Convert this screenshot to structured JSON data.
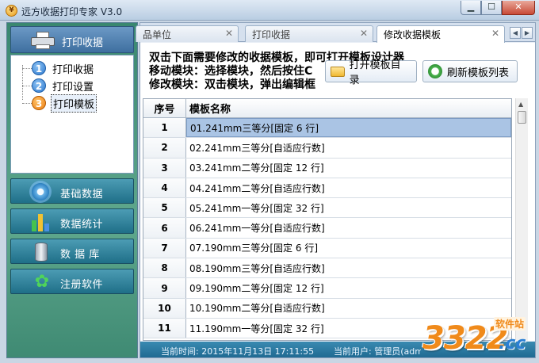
{
  "window": {
    "title": "远方收据打印专家 V3.0",
    "app_icon_glyph": "¥"
  },
  "colors": {
    "accent": "#3e6f9f",
    "nav_button": "#1f6f88",
    "left_panel": "#5fa88d",
    "selection": "#aac4e4",
    "statusbar": "#1f6a92"
  },
  "left_panel": {
    "header_label": "打印收据",
    "header_icon": "printer-icon",
    "tree": [
      {
        "num": "1",
        "label": "打印收据",
        "color": "#2c78cf"
      },
      {
        "num": "2",
        "label": "打印设置",
        "color": "#2c78cf"
      },
      {
        "num": "3",
        "label": "打印模板",
        "color": "#ec7d10",
        "selected": true
      }
    ],
    "nav_buttons": [
      {
        "label": "基础数据",
        "icon": "gear-icon"
      },
      {
        "label": "数据统计",
        "icon": "bar-chart-icon"
      },
      {
        "label": "数 据 库",
        "icon": "database-icon"
      },
      {
        "label": "注册软件",
        "icon": "leaf-icon"
      }
    ]
  },
  "tabs": [
    {
      "label": "品单位",
      "active": false
    },
    {
      "label": "打印收据",
      "active": false
    },
    {
      "label": "修改收据模板",
      "active": true
    }
  ],
  "tab_nav": {
    "left": "◀",
    "right": "▶"
  },
  "instructions": [
    "双击下面需要修改的收据模板，即可打开模板设计器",
    "移动模块：选择模块，然后按住C",
    "修改模块：双击模块，弹出编辑框"
  ],
  "toolbar": {
    "open_dir_label": "打开模板目录",
    "refresh_label": "刷新模板列表"
  },
  "grid": {
    "columns": [
      "序号",
      "模板名称"
    ],
    "rows": [
      {
        "no": "1",
        "name": "01.241mm三等分[固定 6 行]",
        "selected": true
      },
      {
        "no": "2",
        "name": "02.241mm三等分[自适应行数]"
      },
      {
        "no": "3",
        "name": "03.241mm二等分[固定 12 行]"
      },
      {
        "no": "4",
        "name": "04.241mm二等分[自适应行数]"
      },
      {
        "no": "5",
        "name": "05.241mm一等分[固定 32 行]"
      },
      {
        "no": "6",
        "name": "06.241mm一等分[自适应行数]"
      },
      {
        "no": "7",
        "name": "07.190mm三等分[固定 6 行]"
      },
      {
        "no": "8",
        "name": "08.190mm三等分[自适应行数]"
      },
      {
        "no": "9",
        "name": "09.190mm二等分[固定 12 行]"
      },
      {
        "no": "10",
        "name": "10.190mm二等分[自适应行数]"
      },
      {
        "no": "11",
        "name": "11.190mm一等分[固定 32 行]"
      }
    ]
  },
  "statusbar": {
    "time": "当前时间: 2015年11月13日 17:11:55",
    "user": "当前用户: 管理员(admi"
  },
  "watermark": {
    "main": "3322",
    "suffix": ".cc",
    "tag": "软件站"
  }
}
